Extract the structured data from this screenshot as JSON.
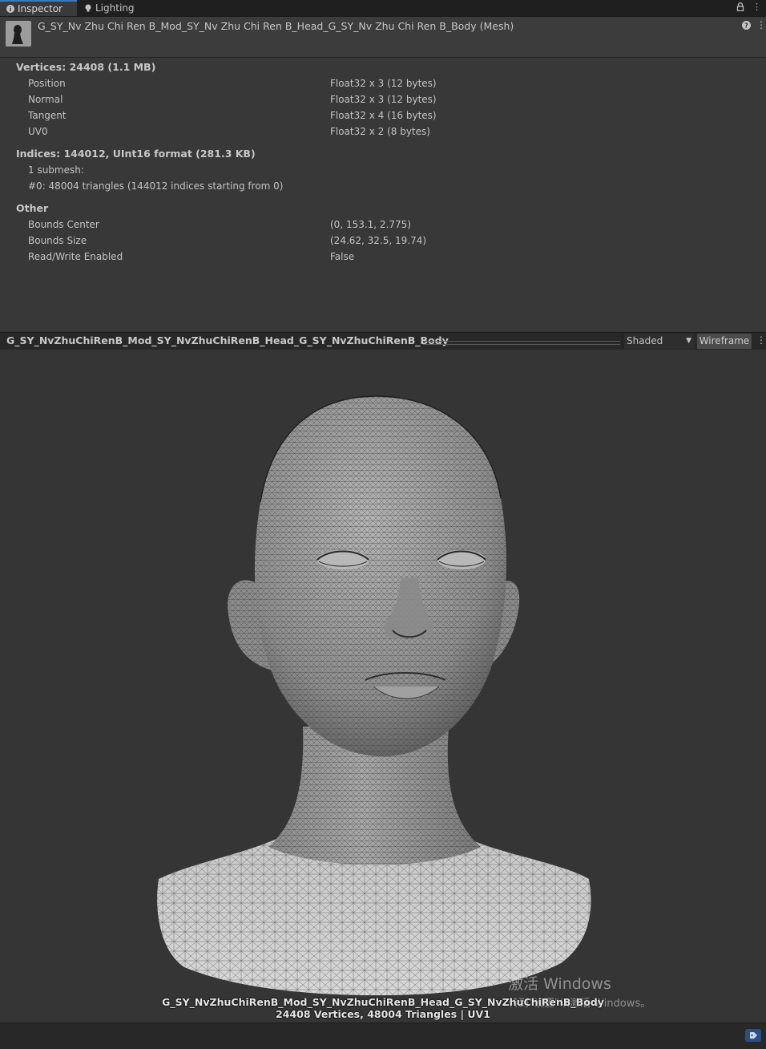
{
  "tabs": [
    {
      "label": "Inspector",
      "icon": "info-icon",
      "active": true
    },
    {
      "label": "Lighting",
      "icon": "lightbulb-icon",
      "active": false
    }
  ],
  "header": {
    "title": "G_SY_Nv Zhu Chi Ren B_Mod_SY_Nv Zhu Chi Ren B_Head_G_SY_Nv Zhu Chi Ren B_Body (Mesh)"
  },
  "vertices": {
    "heading": "Vertices: 24408 (1.1 MB)",
    "attributes": [
      {
        "name": "Position",
        "format": "Float32 x 3 (12 bytes)"
      },
      {
        "name": "Normal",
        "format": "Float32 x 3 (12 bytes)"
      },
      {
        "name": "Tangent",
        "format": "Float32 x 4 (16 bytes)"
      },
      {
        "name": "UV0",
        "format": "Float32 x 2 (8 bytes)"
      }
    ]
  },
  "indices": {
    "heading": "Indices: 144012, UInt16 format (281.3 KB)",
    "submesh_count": "1 submesh:",
    "submesh_0": "#0: 48004 triangles (144012 indices starting from 0)"
  },
  "other": {
    "heading": "Other",
    "props": [
      {
        "name": "Bounds Center",
        "value": "(0, 153.1, 2.775)"
      },
      {
        "name": "Bounds Size",
        "value": "(24.62, 32.5, 19.74)"
      },
      {
        "name": "Read/Write Enabled",
        "value": "False"
      }
    ]
  },
  "preview": {
    "title": "G_SY_NvZhuChiRenB_Mod_SY_NvZhuChiRenB_Head_G_SY_NvZhuChiRenB_Body",
    "shading_mode": "Shaded",
    "wireframe_label": "Wireframe",
    "caption_line1": "G_SY_NvZhuChiRenB_Mod_SY_NvZhuChiRenB_Head_G_SY_NvZhuChiRenB_Body",
    "caption_line2": "24408 Vertices, 48004 Triangles | UV1"
  },
  "watermark": {
    "line1": "激活 Windows",
    "line2": "转到\"设置\"以激活 Windows。"
  },
  "colors": {
    "accent": "#3a79bb",
    "background": "#383838",
    "viewport": "#353535"
  }
}
